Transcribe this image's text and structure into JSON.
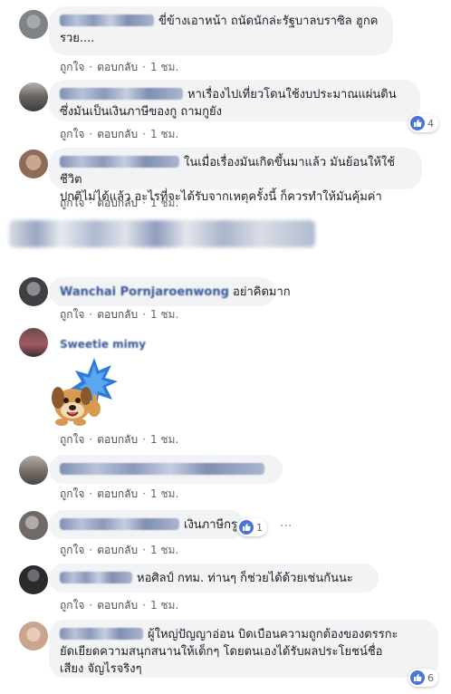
{
  "actions": {
    "like": "ถูกใจ",
    "reply": "ตอบกลับ",
    "separator": "·",
    "time": "1 ชม."
  },
  "comments": [
    {
      "name": "",
      "text_line1": "ขี่ข้างเอาหน้า ถนัดนักล่ะรัฐบาลบราซิล ฮูกค",
      "text_line2": "รวย....",
      "avatar_color": "#8a8d93"
    },
    {
      "name": "",
      "text_line1": "หาเรื่องไปเที่ยวโดนใช้งบประมาณแผ่นดิน",
      "text_line2": "ซึ่งมันเป็นเงินภาษีของกู ถามกูยัง",
      "reactions": "4",
      "avatar_color": "#6d6a66"
    },
    {
      "name": "",
      "text_line1": "ในเมื่อเรื่องมันเกิดขึ้นมาแล้ว มันย้อนให้ใช้ชีวิต",
      "text_line2": "ปกติไม่ได้แล้ว อะไรที่จะได้รับจากเหตุครั้งนี้ ก็ควรทำให้มันคุ้มค่า",
      "avatar_color": "#b6967e"
    },
    {
      "name": "",
      "text_line1": "",
      "text_line2": ""
    },
    {
      "name": "Wanchai Pornjaroenwong",
      "text_line1": "อย่าคิดมาก",
      "avatar_color": "#4e4f53"
    },
    {
      "name": "Sweetie mimy",
      "text_line1": "",
      "avatar_color": "#a05b63"
    },
    {
      "name": "",
      "text_line1": "",
      "avatar_color": "#7a726d"
    },
    {
      "name": "",
      "text_line1": "เงินภาษีกรู",
      "reactions": "1",
      "avatar_color": "#6f6a68"
    },
    {
      "name": "",
      "text_line1": "หอศิลป์ กทม. ท่านๆ ก็ช่วยได้ด้วยเช่นกันนะ",
      "avatar_color": "#2b2b2e"
    },
    {
      "name": "",
      "text_line1": "ผู้ใหญ่ปัญญาอ่อน บิดเบือนความถูกต้องของตรรกะ",
      "text_line2": "ยัดเยียดความสนุกสนานให้เด็กๆ โดยตนเองได้รับผลประโยชน์ชื่อ",
      "text_line3": "เสียง จัญไรจริงๆ",
      "reactions": "6",
      "avatar_color": "#c9a58f"
    }
  ],
  "colors": {
    "link_name": "#385898",
    "bubble": "#f2f3f5",
    "meta": "#606770",
    "like_badge": "#4a75d6"
  }
}
